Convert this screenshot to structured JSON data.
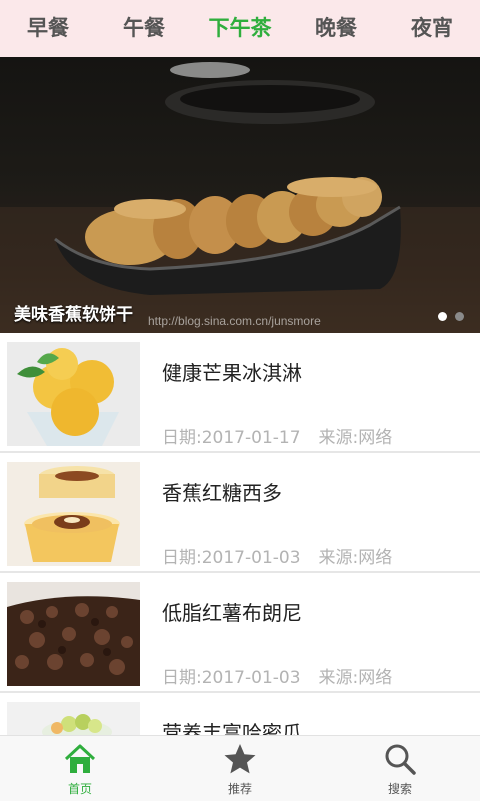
{
  "tabs": [
    {
      "label": "早餐"
    },
    {
      "label": "午餐"
    },
    {
      "label": "下午茶"
    },
    {
      "label": "晚餐"
    },
    {
      "label": "夜宵"
    }
  ],
  "active_tab_color": "#2fae3d",
  "banner": {
    "caption": "美味香蕉软饼干",
    "watermark": "http://blog.sina.com.cn/junsmore",
    "slide_count": 2,
    "active_slide": 1
  },
  "articles": [
    {
      "title": "健康芒果冰淇淋",
      "date": "日期:2017-01-17",
      "source": "来源:网络",
      "thumb": "mango-ice-cream-image"
    },
    {
      "title": "香蕉红糖西多",
      "date": "日期:2017-01-03",
      "source": "来源:网络",
      "thumb": "banana-pudding-image"
    },
    {
      "title": "低脂红薯布朗尼",
      "date": "日期:2017-01-03",
      "source": "来源:网络",
      "thumb": "brownie-image"
    },
    {
      "title": "营养丰富哈密瓜",
      "date": "",
      "source": "",
      "thumb": "melon-image"
    }
  ],
  "bottom_nav": [
    {
      "label": "首页",
      "icon": "home-icon"
    },
    {
      "label": "推荐",
      "icon": "star-icon"
    },
    {
      "label": "搜索",
      "icon": "search-icon"
    }
  ]
}
